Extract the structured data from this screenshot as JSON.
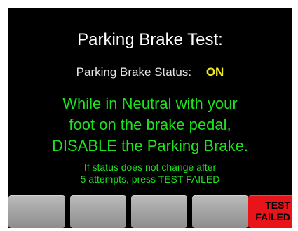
{
  "screen": {
    "title": "Parking Brake Test:",
    "status_label": "Parking Brake Status:",
    "status_value": "ON",
    "instructions": [
      "While in Neutral with your",
      "foot on the brake pedal,",
      "DISABLE the Parking Brake."
    ],
    "note": [
      "If status does not change after",
      "5 attempts, press TEST FAILED"
    ]
  },
  "softkeys": {
    "test_failed_line1": "TEST",
    "test_failed_line2": "FAILED"
  },
  "colors": {
    "background": "#000000",
    "title": "#ffffff",
    "status_value": "#f2ea1b",
    "instruction_text": "#1fe21f",
    "test_failed_button": "#e8141a"
  }
}
